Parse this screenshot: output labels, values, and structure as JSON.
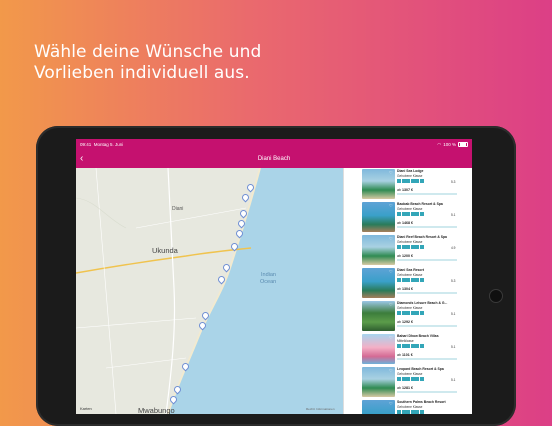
{
  "headline": {
    "line1": "Wähle deine Wünsche und",
    "line2": "Vorlieben individuell aus."
  },
  "statusbar": {
    "time": "09:41",
    "date": "Montag 5. Juni",
    "battery": "100 %"
  },
  "navbar": {
    "title": "Diani Beach",
    "back_icon": "chevron-left-icon"
  },
  "map": {
    "labels": {
      "diani": "Diani",
      "ukunda": "Ukunda",
      "ocean_line1": "Indian",
      "ocean_line2": "Ocean",
      "mwabungo": "Mwabungo",
      "apple_maps": "Karten",
      "legal": "Rechtl. Informationen"
    }
  },
  "hotels": [
    {
      "name": "Diani Sea Lodge",
      "class": "Gehobene Klasse",
      "score": "5.3",
      "price_prefix": "ab",
      "price": "1307 €",
      "thumb": "beach"
    },
    {
      "name": "Baobab Beach Resort & Spa",
      "class": "Gehobene Klasse",
      "score": "5.1",
      "price_prefix": "ab",
      "price": "1468 €",
      "thumb": "pool"
    },
    {
      "name": "Diani Reef Beach Resort & Spa",
      "class": "Gehobene Klasse",
      "score": "4.9",
      "price_prefix": "ab",
      "price": "1200 €",
      "thumb": "beach"
    },
    {
      "name": "Diani Sea Resort",
      "class": "Gehobene Klasse",
      "score": "5.3",
      "price_prefix": "ab",
      "price": "1304 €",
      "thumb": "pool"
    },
    {
      "name": "Diamonds Leisure Beach & G...",
      "class": "Gehobene Klasse",
      "score": "5.1",
      "price_prefix": "ab",
      "price": "1292 €",
      "thumb": "green"
    },
    {
      "name": "Bahari Dhow Beach Villas",
      "class": "Mittelklasse",
      "score": "5.1",
      "price_prefix": "ab",
      "price": "1101 €",
      "thumb": "pink"
    },
    {
      "name": "Leopard Beach Resort & Spa",
      "class": "Gehobene Klasse",
      "score": "5.1",
      "price_prefix": "ab",
      "price": "1281 €",
      "thumb": "beach"
    },
    {
      "name": "Southern Palms Beach Resort",
      "class": "Gehobene Klasse",
      "score": "",
      "price_prefix": "",
      "price": "",
      "thumb": "pool"
    }
  ]
}
